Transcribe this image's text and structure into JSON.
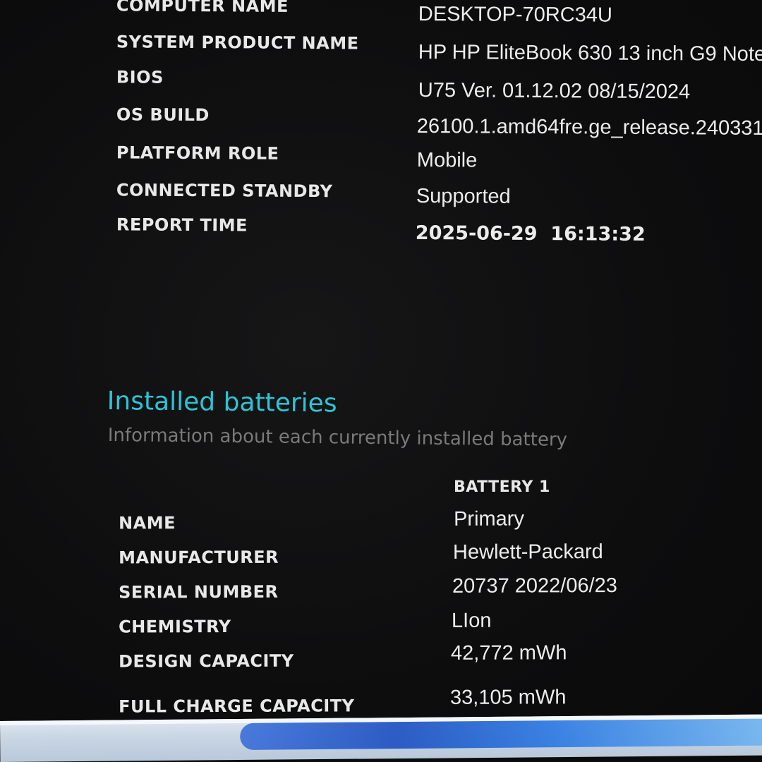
{
  "system_info": [
    {
      "label": "COMPUTER NAME",
      "value": "DESKTOP-70RC34U"
    },
    {
      "label": "SYSTEM PRODUCT NAME",
      "value": "HP HP EliteBook 630 13 inch G9 Note"
    },
    {
      "label": "BIOS",
      "value": "U75 Ver. 01.12.02 08/15/2024"
    },
    {
      "label": "OS BUILD",
      "value": "26100.1.amd64fre.ge_release.240331-"
    },
    {
      "label": "PLATFORM ROLE",
      "value": "Mobile"
    },
    {
      "label": "CONNECTED STANDBY",
      "value": "Supported"
    },
    {
      "label": "REPORT TIME",
      "value": "2025-06-29  16:13:32"
    }
  ],
  "batteries_section": {
    "title": "Installed batteries",
    "subtitle": "Information about each currently installed battery",
    "column_header": "BATTERY 1",
    "rows": [
      {
        "label": "NAME",
        "value": "Primary"
      },
      {
        "label": "MANUFACTURER",
        "value": "Hewlett-Packard"
      },
      {
        "label": "SERIAL NUMBER",
        "value": "20737 2022/06/23"
      },
      {
        "label": "CHEMISTRY",
        "value": "LIon"
      },
      {
        "label": "DESIGN CAPACITY",
        "value": "42,772 mWh"
      },
      {
        "label": "FULL CHARGE CAPACITY",
        "value": "33,105 mWh"
      }
    ]
  },
  "colors": {
    "background": "#0e0e0f",
    "heading_accent": "#2ec4d6",
    "subtitle": "#7a7a7a",
    "text": "#ececec"
  }
}
